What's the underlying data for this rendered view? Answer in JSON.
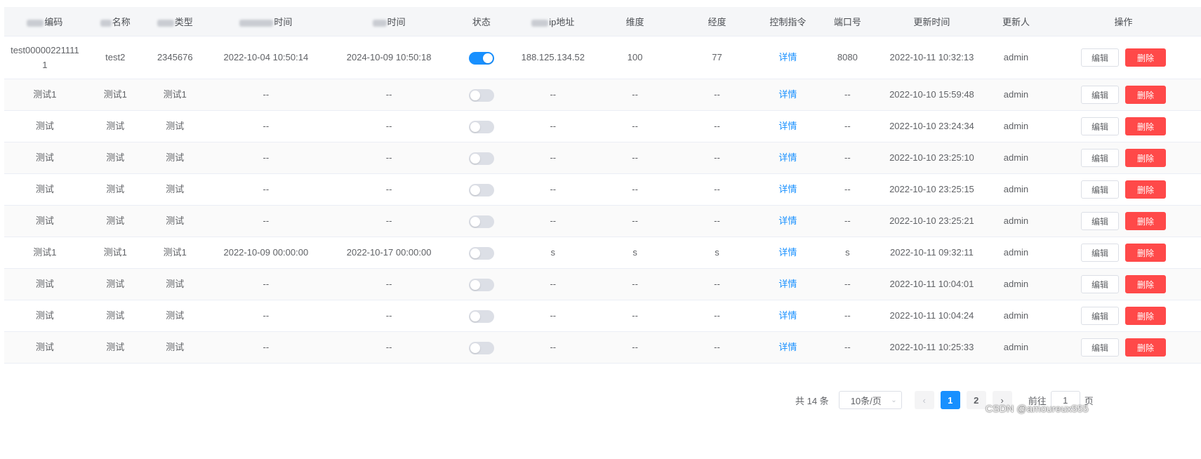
{
  "table": {
    "columns": [
      "编码",
      "名称",
      "类型",
      "时间",
      "时间",
      "状态",
      "ip地址",
      "维度",
      "经度",
      "控制指令",
      "端口号",
      "更新时间",
      "更新人",
      "操作"
    ],
    "rows": [
      {
        "code": "test000002211111",
        "name": "test2",
        "type": "2345676",
        "t1": "2022-10-04 10:50:14",
        "t2": "2024-10-09 10:50:18",
        "status": true,
        "ip": "188.125.134.52",
        "lat": "100",
        "lng": "77",
        "cmd": "详情",
        "port": "8080",
        "updated": "2022-10-11 10:32:13",
        "user": "admin"
      },
      {
        "code": "测试1",
        "name": "测试1",
        "type": "测试1",
        "t1": "--",
        "t2": "--",
        "status": false,
        "ip": "--",
        "lat": "--",
        "lng": "--",
        "cmd": "详情",
        "port": "--",
        "updated": "2022-10-10 15:59:48",
        "user": "admin"
      },
      {
        "code": "测试",
        "name": "测试",
        "type": "测试",
        "t1": "--",
        "t2": "--",
        "status": false,
        "ip": "--",
        "lat": "--",
        "lng": "--",
        "cmd": "详情",
        "port": "--",
        "updated": "2022-10-10 23:24:34",
        "user": "admin"
      },
      {
        "code": "测试",
        "name": "测试",
        "type": "测试",
        "t1": "--",
        "t2": "--",
        "status": false,
        "ip": "--",
        "lat": "--",
        "lng": "--",
        "cmd": "详情",
        "port": "--",
        "updated": "2022-10-10 23:25:10",
        "user": "admin"
      },
      {
        "code": "测试",
        "name": "测试",
        "type": "测试",
        "t1": "--",
        "t2": "--",
        "status": false,
        "ip": "--",
        "lat": "--",
        "lng": "--",
        "cmd": "详情",
        "port": "--",
        "updated": "2022-10-10 23:25:15",
        "user": "admin"
      },
      {
        "code": "测试",
        "name": "测试",
        "type": "测试",
        "t1": "--",
        "t2": "--",
        "status": false,
        "ip": "--",
        "lat": "--",
        "lng": "--",
        "cmd": "详情",
        "port": "--",
        "updated": "2022-10-10 23:25:21",
        "user": "admin"
      },
      {
        "code": "测试1",
        "name": "测试1",
        "type": "测试1",
        "t1": "2022-10-09 00:00:00",
        "t2": "2022-10-17 00:00:00",
        "status": false,
        "ip": "s",
        "lat": "s",
        "lng": "s",
        "cmd": "详情",
        "port": "s",
        "updated": "2022-10-11 09:32:11",
        "user": "admin"
      },
      {
        "code": "测试",
        "name": "测试",
        "type": "测试",
        "t1": "--",
        "t2": "--",
        "status": false,
        "ip": "--",
        "lat": "--",
        "lng": "--",
        "cmd": "详情",
        "port": "--",
        "updated": "2022-10-11 10:04:01",
        "user": "admin"
      },
      {
        "code": "测试",
        "name": "测试",
        "type": "测试",
        "t1": "--",
        "t2": "--",
        "status": false,
        "ip": "--",
        "lat": "--",
        "lng": "--",
        "cmd": "详情",
        "port": "--",
        "updated": "2022-10-11 10:04:24",
        "user": "admin"
      },
      {
        "code": "测试",
        "name": "测试",
        "type": "测试",
        "t1": "--",
        "t2": "--",
        "status": false,
        "ip": "--",
        "lat": "--",
        "lng": "--",
        "cmd": "详情",
        "port": "--",
        "updated": "2022-10-11 10:25:33",
        "user": "admin"
      }
    ],
    "edit_label": "编辑",
    "delete_label": "删除"
  },
  "pagination": {
    "total": "共 14 条",
    "page_size": "10条/页",
    "prev_icon": "chevron-left-icon",
    "next_icon": "chevron-right-icon",
    "pages": [
      "1",
      "2"
    ],
    "current_page": "1",
    "goto_label": "前往",
    "goto_value": "1",
    "page_suffix": "页"
  },
  "watermark": "CSDN @amoureux555",
  "colors": {
    "primary": "#1890ff",
    "danger": "#ff4949",
    "header_bg": "#f5f6f8",
    "stripe": "#fafafa"
  }
}
